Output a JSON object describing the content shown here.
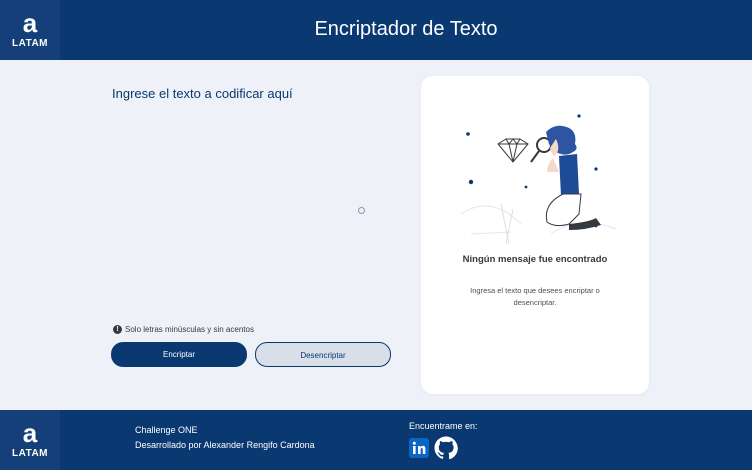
{
  "header": {
    "logo_mark": "a",
    "logo_text": "LATAM",
    "title": "Encriptador de Texto"
  },
  "input": {
    "label": "Ingrese el texto a codificar aquí",
    "value": "",
    "hint_icon": "info-icon",
    "hint": "Solo letras minúsculas y sin acentos"
  },
  "buttons": {
    "encrypt": "Encriptar",
    "decrypt": "Desencriptar"
  },
  "output": {
    "title": "Ningún mensaje fue encontrado",
    "description": "Ingresa el texto que desees encriptar o desencriptar."
  },
  "footer": {
    "logo_mark": "a",
    "logo_text": "LATAM",
    "line1": "Challenge ONE",
    "line2": "Desarrollado por Alexander Rengifo Cardona",
    "find_me": "Encuentrame en:",
    "social": [
      "linkedin-icon",
      "github-icon"
    ]
  },
  "colors": {
    "primary": "#0a3871",
    "background": "#eef2f8",
    "card": "#ffffff",
    "secondary_button": "#d8dfe8"
  }
}
